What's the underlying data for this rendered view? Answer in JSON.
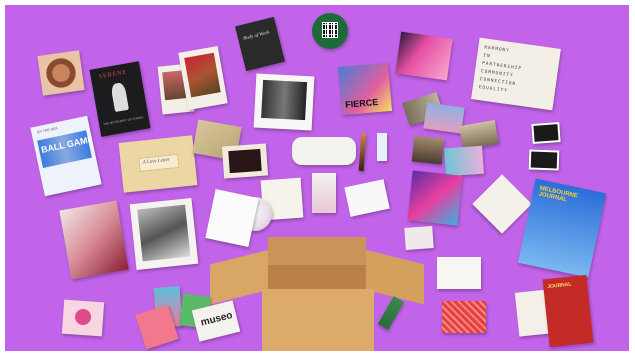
{
  "items": {
    "dark_booklet": {
      "title": "SERENE",
      "subtitle": "THE MOVEMENT OF FORMS"
    },
    "black_zine": {
      "title": "Body of Work"
    },
    "blue_zine": {
      "top": "BY THE SEA",
      "title": "BALL GAMES"
    },
    "envelope": {
      "label": "A Love Letter"
    },
    "fierce_card": {
      "word": "FIERCE"
    },
    "harmony_poster": {
      "lines": [
        "HARMONY",
        "IN",
        "PARTNERSHIP",
        "COMMUNITY",
        "CONNECTION",
        "EQUALITY"
      ]
    },
    "blue_poster": {
      "title": "MELBOURNE JOURNAL"
    },
    "red_zine": {
      "title": "JOURNAL"
    },
    "small_card": {
      "word": "museo"
    },
    "heart_sticker": {
      "label": "ARE YOU?"
    }
  },
  "colors": {
    "background": "#c264ea",
    "box": "#d9a765"
  }
}
